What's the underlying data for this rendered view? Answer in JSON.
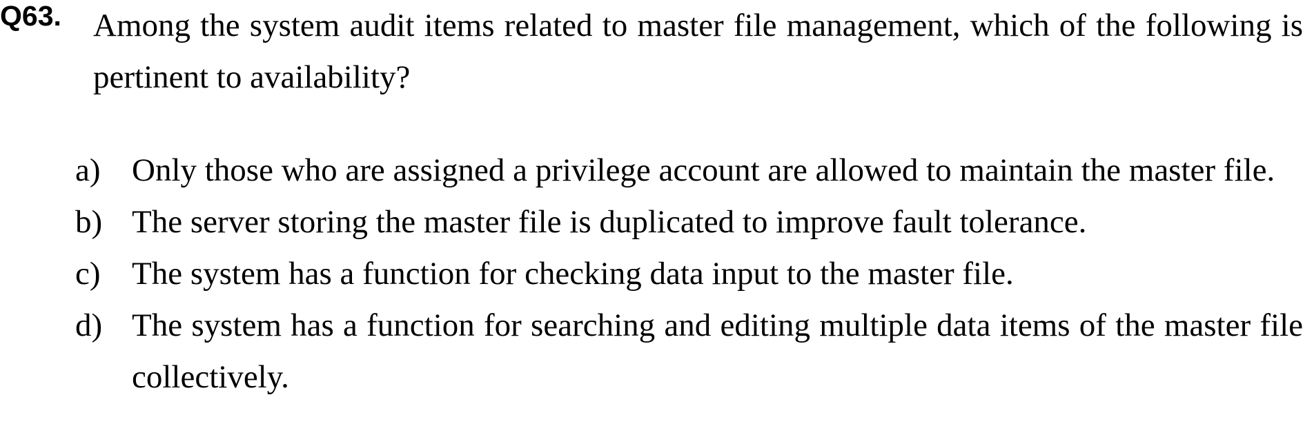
{
  "question": {
    "number": "Q63.",
    "text": "Among the system audit items related to master file management, which of the following is pertinent to availability?"
  },
  "options": [
    {
      "label": "a)",
      "text": "Only those who are assigned a privilege account are allowed to maintain the master file."
    },
    {
      "label": "b)",
      "text": "The server storing the master file is duplicated to improve fault tolerance."
    },
    {
      "label": "c)",
      "text": "The system has a function for checking data input to the master file."
    },
    {
      "label": "d)",
      "text": "The system has a function for searching and editing multiple data items of the master file collectively."
    }
  ]
}
